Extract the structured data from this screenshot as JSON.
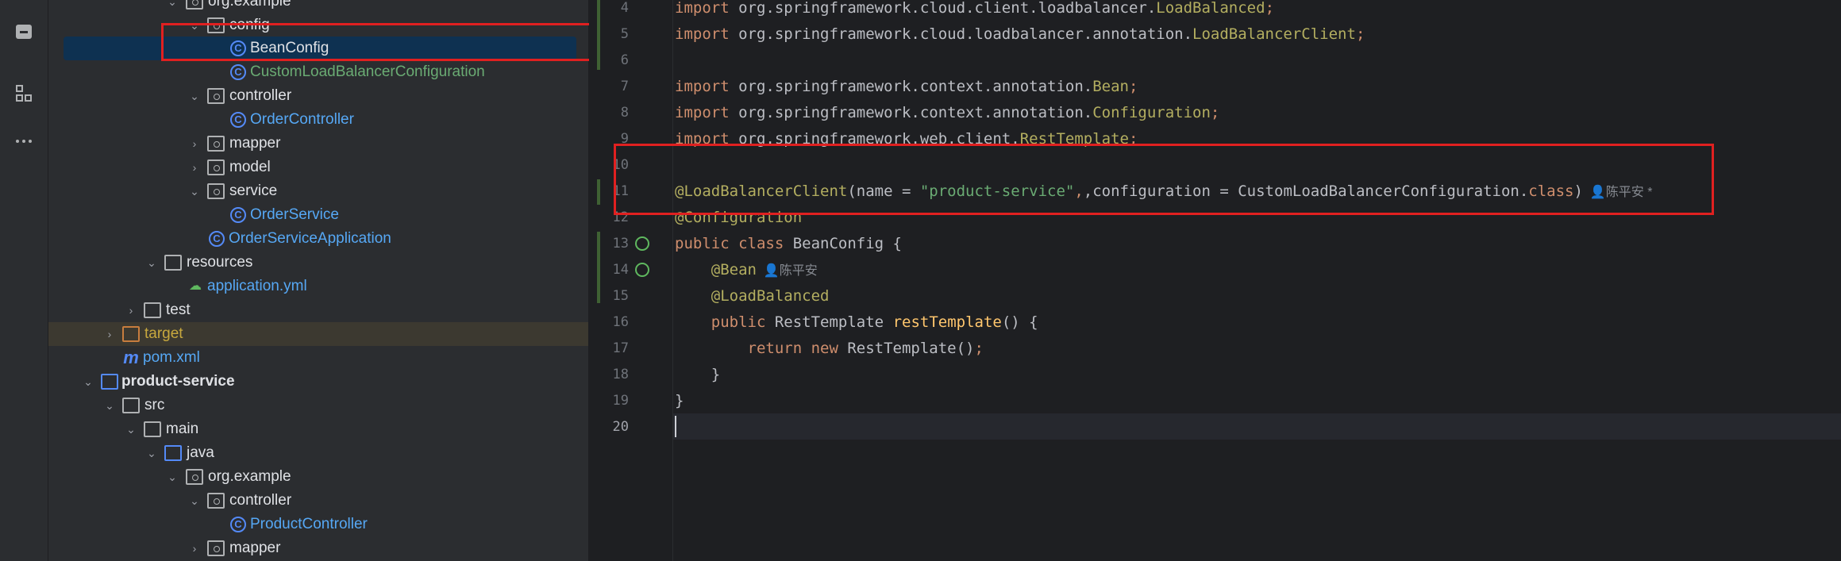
{
  "activity_bar": {
    "icons": [
      "project-icon",
      "structure-icon",
      "more-icon"
    ]
  },
  "project_tree": {
    "rows": [
      {
        "label": "org.example",
        "icon": "package-folder-icon",
        "expanded": true
      },
      {
        "label": "config",
        "icon": "package-folder-icon",
        "expanded": true
      },
      {
        "label": "BeanConfig",
        "icon": "class-icon",
        "selected": true
      },
      {
        "label": "CustomLoadBalancerConfiguration",
        "icon": "class-icon",
        "color": "#6aab73"
      },
      {
        "label": "controller",
        "icon": "package-folder-icon",
        "expanded": true
      },
      {
        "label": "OrderController",
        "icon": "class-icon"
      },
      {
        "label": "mapper",
        "icon": "package-folder-icon",
        "expanded": false
      },
      {
        "label": "model",
        "icon": "package-folder-icon",
        "expanded": false
      },
      {
        "label": "service",
        "icon": "package-folder-icon",
        "expanded": true
      },
      {
        "label": "OrderService",
        "icon": "class-icon"
      },
      {
        "label": "OrderServiceApplication",
        "icon": "spring-class-icon"
      },
      {
        "label": "resources",
        "icon": "resources-folder-icon",
        "expanded": true
      },
      {
        "label": "application.yml",
        "icon": "yaml-icon"
      },
      {
        "label": "test",
        "icon": "folder-icon",
        "expanded": false
      },
      {
        "label": "target",
        "icon": "excluded-folder-icon",
        "expanded": false,
        "color": "#c7a83e"
      },
      {
        "label": "pom.xml",
        "icon": "maven-icon"
      },
      {
        "label": "product-service",
        "icon": "module-folder-icon",
        "expanded": true,
        "bold": true
      },
      {
        "label": "src",
        "icon": "folder-icon",
        "expanded": true
      },
      {
        "label": "main",
        "icon": "folder-icon",
        "expanded": true
      },
      {
        "label": "java",
        "icon": "source-folder-icon",
        "expanded": true
      },
      {
        "label": "org.example",
        "icon": "package-folder-icon",
        "expanded": true
      },
      {
        "label": "controller",
        "icon": "package-folder-icon",
        "expanded": true
      },
      {
        "label": "ProductController",
        "icon": "class-icon"
      },
      {
        "label": "mapper",
        "icon": "package-folder-icon",
        "expanded": false
      }
    ]
  },
  "editor": {
    "line_numbers": [
      "4",
      "5",
      "6",
      "7",
      "8",
      "9",
      "10",
      "11",
      "12",
      "13",
      "14",
      "15",
      "16",
      "17",
      "18",
      "19",
      "20"
    ],
    "current_line": "20",
    "lines": {
      "l4": {
        "kw": "import",
        "pkg": " org.springframework.cloud.client.loadbalancer.",
        "cls": "LoadBalanced",
        "end": ";"
      },
      "l5": {
        "kw": "import",
        "pkg": " org.springframework.cloud.loadbalancer.annotation.",
        "cls": "LoadBalancerClient",
        "end": ";"
      },
      "l7": {
        "kw": "import",
        "pkg": " org.springframework.context.annotation.",
        "cls": "Bean",
        "end": ";"
      },
      "l8": {
        "kw": "import",
        "pkg": " org.springframework.context.annotation.",
        "cls": "Configuration",
        "end": ";"
      },
      "l9": {
        "kw": "import",
        "pkg": " org.springframework.web.client.",
        "cls": "RestTemplate",
        "end": ";"
      },
      "l11": {
        "ann": "@LoadBalancerClient",
        "p1": "(name = ",
        "str": "\"product-service\"",
        "p2": ",configuration = CustomLoadBalancerConfiguration.",
        "kw": "class",
        "p3": ")",
        "author": "陈平安 *"
      },
      "l12": {
        "ann": "@Configuration"
      },
      "l13": {
        "kw": "public class",
        "rest": " BeanConfig {"
      },
      "l14": {
        "ann": "@Bean",
        "author": "陈平安"
      },
      "l15": {
        "ann": "@LoadBalanced"
      },
      "l16": {
        "kw": "public",
        "type": " RestTemplate ",
        "fn": "restTemplate",
        "rest": "() {"
      },
      "l17": {
        "kw": "return new",
        "rest": " RestTemplate()",
        "end": ";"
      },
      "l18": {
        "rest": "}"
      },
      "l19": {
        "rest": "}"
      }
    }
  },
  "colors": {
    "highlight_box": "#e02020",
    "selection": "#0e3151"
  }
}
